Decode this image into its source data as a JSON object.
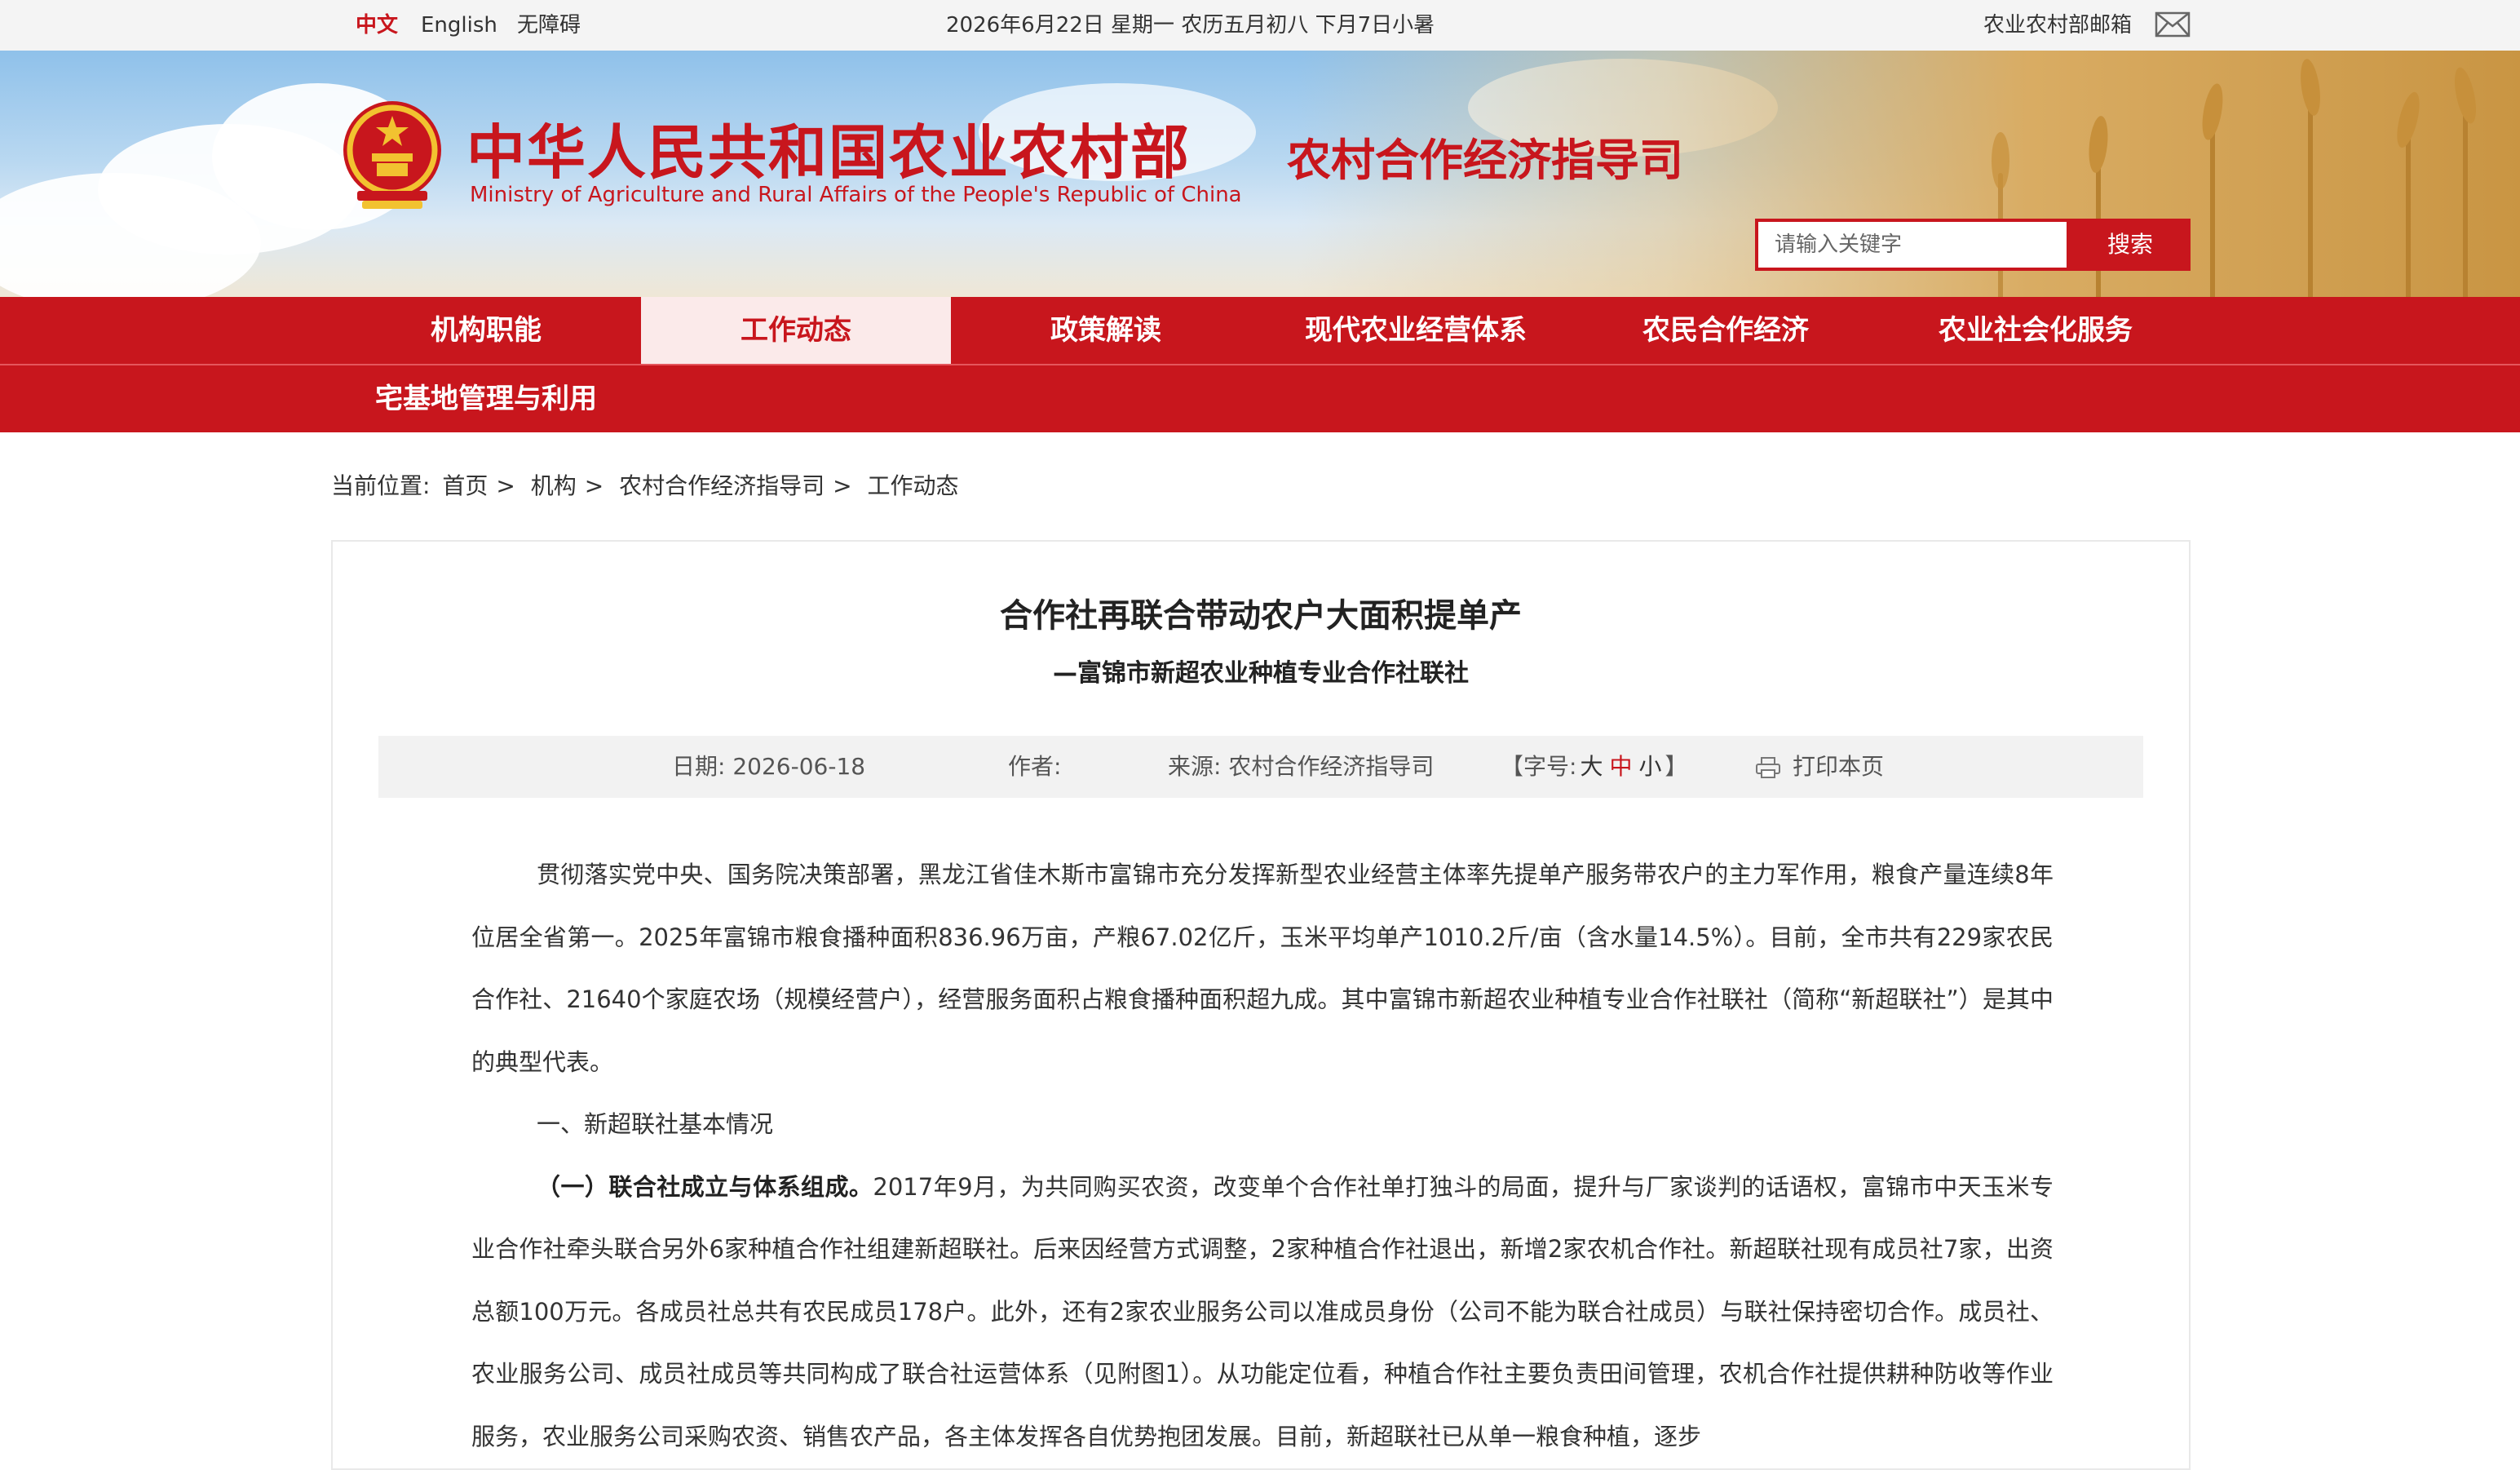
{
  "topbar": {
    "lang_zh": "中文",
    "lang_en": "English",
    "accessibility": "无障碍",
    "date_line": "2026年6月22日 星期一 农历五月初八 下月7日小暑",
    "mail_label": "农业农村部邮箱"
  },
  "header": {
    "site_title": "中华人民共和国农业农村部",
    "site_title_en": "Ministry of Agriculture and Rural Affairs of the People's Republic of China",
    "dept_title": "农村合作经济指导司",
    "search_placeholder": "请输入关键字",
    "search_button": "搜索"
  },
  "nav": {
    "items": [
      {
        "label": "机构职能",
        "active": false
      },
      {
        "label": "工作动态",
        "active": true
      },
      {
        "label": "政策解读",
        "active": false
      },
      {
        "label": "现代农业经营体系",
        "active": false
      },
      {
        "label": "农民合作经济",
        "active": false
      },
      {
        "label": "农业社会化服务",
        "active": false
      },
      {
        "label": "宅基地管理与利用",
        "active": false
      }
    ]
  },
  "breadcrumb": {
    "prefix": "当前位置:",
    "items": [
      "首页",
      "机构",
      "农村合作经济指导司",
      "工作动态"
    ],
    "separator": ">"
  },
  "article": {
    "title": "合作社再联合带动农户大面积提单产",
    "subtitle": "—富锦市新超农业种植专业合作社联社",
    "meta": {
      "date_label": "日期:",
      "date": "2026-06-18",
      "author_label": "作者:",
      "author": "",
      "source_label": "来源:",
      "source": "农村合作经济指导司",
      "font_prefix": "【字号:",
      "font_large": "大",
      "font_medium": "中",
      "font_small": "小",
      "font_suffix": "】",
      "print": "打印本页"
    },
    "paragraphs": [
      {
        "lead": "",
        "text": "贯彻落实党中央、国务院决策部署，黑龙江省佳木斯市富锦市充分发挥新型农业经营主体率先提单产服务带农户的主力军作用，粮食产量连续8年位居全省第一。2025年富锦市粮食播种面积836.96万亩，产粮67.02亿斤，玉米平均单产1010.2斤/亩（含水量14.5%）。目前，全市共有229家农民合作社、21640个家庭农场（规模经营户），经营服务面积占粮食播种面积超九成。其中富锦市新超农业种植专业合作社联社（简称“新超联社”）是其中的典型代表。"
      },
      {
        "lead": "",
        "text": "一、新超联社基本情况"
      },
      {
        "lead": "（一）联合社成立与体系组成。",
        "text": "2017年9月，为共同购买农资，改变单个合作社单打独斗的局面，提升与厂家谈判的话语权，富锦市中天玉米专业合作社牵头联合另外6家种植合作社组建新超联社。后来因经营方式调整，2家种植合作社退出，新增2家农机合作社。新超联社现有成员社7家，出资总额100万元。各成员社总共有农民成员178户。此外，还有2家农业服务公司以准成员身份（公司不能为联合社成员）与联社保持密切合作。成员社、农业服务公司、成员社成员等共同构成了联合社运营体系（见附图1）。从功能定位看，种植合作社主要负责田间管理，农机合作社提供耕种防收等作业服务，农业服务公司采购农资、销售农产品，各主体发挥各自优势抱团发展。目前，新超联社已从单一粮食种植，逐步"
      }
    ]
  },
  "colors": {
    "brand_red": "#c8161d",
    "nav_active_bg": "#fbeaea",
    "meta_bg": "#f2f2f2",
    "topbar_bg": "#f4f4f4"
  },
  "icons": {
    "mail": "envelope-icon",
    "emblem": "national-emblem",
    "print": "printer-icon"
  }
}
